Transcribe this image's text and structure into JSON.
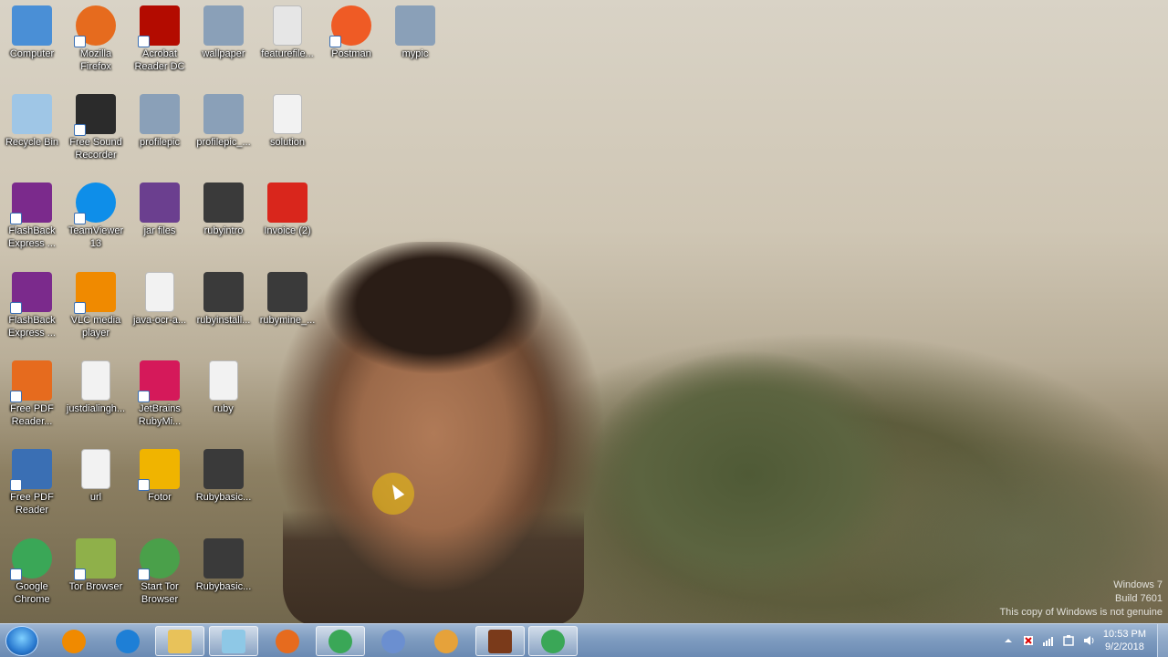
{
  "desktop": {
    "icons": [
      {
        "label": "Computer",
        "icon": "computer-icon",
        "color": "#4a8fd6"
      },
      {
        "label": "Mozilla Firefox",
        "icon": "firefox-icon",
        "color": "#e66b1e"
      },
      {
        "label": "Acrobat Reader DC",
        "icon": "acrobat-icon",
        "color": "#b30b00"
      },
      {
        "label": "wallpaper",
        "icon": "image-icon",
        "color": "#8aa0b8"
      },
      {
        "label": "featurefile...",
        "icon": "file-icon",
        "color": "#e6e6e6"
      },
      {
        "label": "Postman",
        "icon": "postman-icon",
        "color": "#ef5b25"
      },
      {
        "label": "mypic",
        "icon": "image-icon",
        "color": "#8aa0b8"
      },
      {
        "label": "Recycle Bin",
        "icon": "recycle-bin-icon",
        "color": "#9fc6e6"
      },
      {
        "label": "Free Sound Recorder",
        "icon": "microphone-icon",
        "color": "#2b2b2b"
      },
      {
        "label": "profilepic",
        "icon": "image-icon",
        "color": "#8aa0b8"
      },
      {
        "label": "profilepic_...",
        "icon": "image-icon",
        "color": "#8aa0b8"
      },
      {
        "label": "solution",
        "icon": "document-icon",
        "color": "#f2f2f2"
      },
      {
        "label": "FlashBack Express ...",
        "icon": "flashback-icon",
        "color": "#7b2a8c"
      },
      {
        "label": "TeamViewer 13",
        "icon": "teamviewer-icon",
        "color": "#0e8ee9"
      },
      {
        "label": "jar files",
        "icon": "winrar-icon",
        "color": "#6b3f8f"
      },
      {
        "label": "rubyintro",
        "icon": "video-icon",
        "color": "#3a3a3a"
      },
      {
        "label": "Invoice (2)",
        "icon": "pdf-icon",
        "color": "#d9261c"
      },
      {
        "label": "FlashBack Express ...",
        "icon": "flashback-icon",
        "color": "#7b2a8c"
      },
      {
        "label": "VLC media player",
        "icon": "vlc-icon",
        "color": "#f08a00"
      },
      {
        "label": "java-ocr-a...",
        "icon": "java-file-icon",
        "color": "#f2f2f2"
      },
      {
        "label": "rubyinstall...",
        "icon": "video-icon",
        "color": "#3a3a3a"
      },
      {
        "label": "rubymine_...",
        "icon": "video-icon",
        "color": "#3a3a3a"
      },
      {
        "label": "Free PDF Reader...",
        "icon": "pdf-reader-icon",
        "color": "#e66b1e"
      },
      {
        "label": "justdialingh...",
        "icon": "document-icon",
        "color": "#f2f2f2"
      },
      {
        "label": "JetBrains RubyMi...",
        "icon": "rubymine-icon",
        "color": "#d5195a"
      },
      {
        "label": "ruby",
        "icon": "document-icon",
        "color": "#f2f2f2"
      },
      {
        "label": "Free PDF Reader",
        "icon": "pdf-reader-icon",
        "color": "#3a6fb4"
      },
      {
        "label": "url",
        "icon": "document-icon",
        "color": "#f2f2f2"
      },
      {
        "label": "Fotor",
        "icon": "fotor-icon",
        "color": "#f0b400"
      },
      {
        "label": "Rubybasic...",
        "icon": "video-icon",
        "color": "#3a3a3a"
      },
      {
        "label": "Google Chrome",
        "icon": "chrome-icon",
        "color": "#3aa757"
      },
      {
        "label": "Tor Browser",
        "icon": "tor-folder-icon",
        "color": "#8fb04a"
      },
      {
        "label": "Start Tor Browser",
        "icon": "tor-globe-icon",
        "color": "#4aa04a"
      },
      {
        "label": "Rubybasic...",
        "icon": "video-icon",
        "color": "#3a3a3a"
      }
    ]
  },
  "taskbar": {
    "start": {
      "icon": "windows-start-icon"
    },
    "buttons": [
      {
        "name": "media-player",
        "icon": "media-player-icon",
        "color": "#f08a00",
        "active": false
      },
      {
        "name": "internet-explorer",
        "icon": "internet-explorer-icon",
        "color": "#1e7fd6",
        "active": false
      },
      {
        "name": "file-explorer",
        "icon": "folder-icon",
        "color": "#e8c25a",
        "active": true
      },
      {
        "name": "notepad",
        "icon": "notepad-icon",
        "color": "#8ec8e6",
        "active": true
      },
      {
        "name": "firefox",
        "icon": "firefox-icon",
        "color": "#e66b1e",
        "active": false
      },
      {
        "name": "chrome",
        "icon": "chrome-icon",
        "color": "#3aa757",
        "active": true
      },
      {
        "name": "viewer",
        "icon": "eyes-icon",
        "color": "#6b8fd0",
        "active": false
      },
      {
        "name": "paint",
        "icon": "paint-icon",
        "color": "#e6a23a",
        "active": false
      },
      {
        "name": "java-ide",
        "icon": "java-ide-icon",
        "color": "#7a3a1a",
        "active": true
      },
      {
        "name": "chrome-2",
        "icon": "chrome-icon",
        "color": "#3aa757",
        "active": true
      }
    ],
    "tray": {
      "icons": [
        "show-hidden-icons-icon",
        "action-center-icon",
        "network-icon",
        "power-icon",
        "volume-icon"
      ],
      "time": "10:53 PM",
      "date": "9/2/2018"
    }
  },
  "watermark": {
    "line1": "Windows 7",
    "line2": "Build 7601",
    "line3": "This copy of Windows is not genuine"
  }
}
